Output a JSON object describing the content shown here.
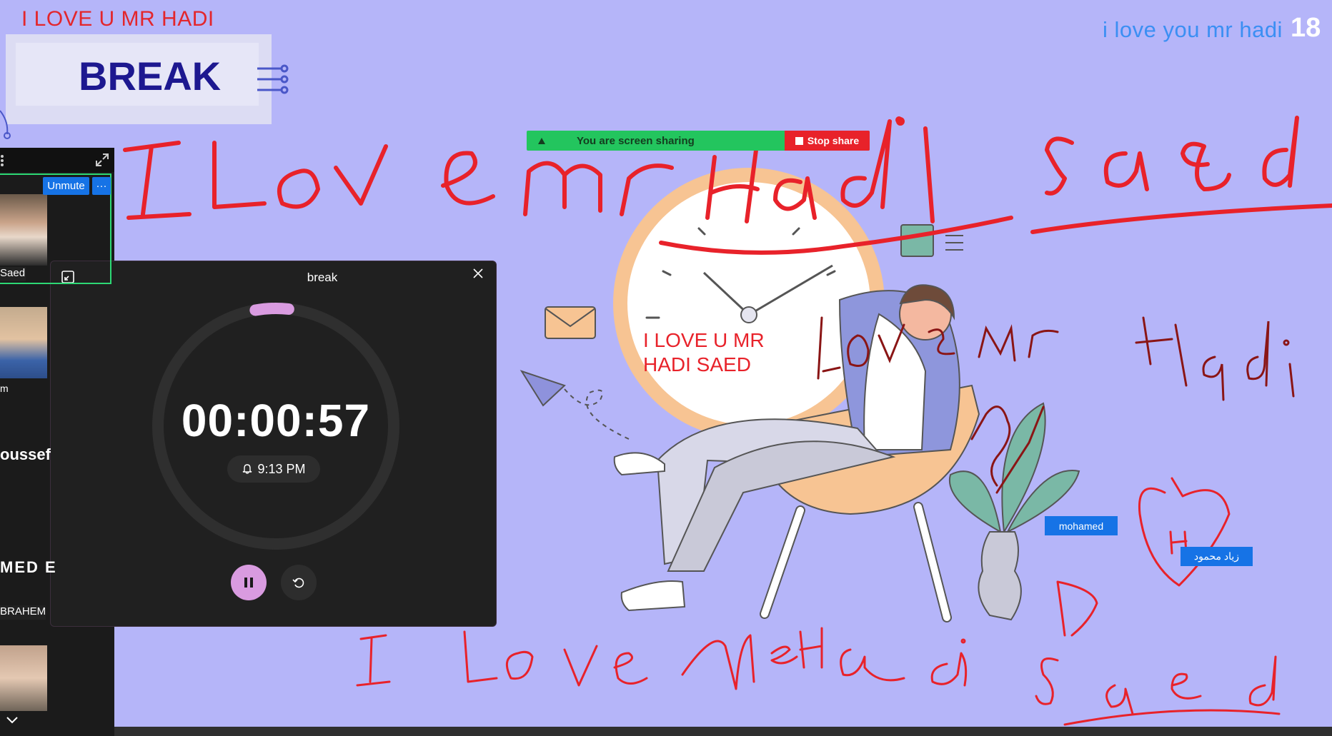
{
  "slide": {
    "red_note_top": "I LOVE U MR HADI",
    "title": "BREAK",
    "top_right_note": "i love you mr hadi",
    "top_right_number": "18",
    "clock_face_note_line1": "I LOVE U MR",
    "clock_face_note_line2": "HADI SAED",
    "background_color": "#b5b5f9"
  },
  "share_bar": {
    "status_text": "You are screen sharing",
    "stop_label": "Stop share",
    "icons": [
      "pin-icon",
      "mic-off-icon",
      "cloud-icon",
      "shield-icon"
    ],
    "bar_color": "#23c55e",
    "stop_color": "#e8222a"
  },
  "participants_panel": {
    "unmute_label": "Unmute",
    "more_label": "···",
    "names": {
      "saed": "Saed",
      "m": "m",
      "youssef": "oussef",
      "med": "MED E",
      "brahem": "BRAHEM"
    }
  },
  "clock_app": {
    "window_title": "break",
    "timer_value": "00:00:57",
    "alarm_time": "9:13 PM",
    "timer_progress": 0.045,
    "accent_color": "#d99be0"
  },
  "name_chips": {
    "mohamed": "mohamed",
    "ziad": "زياد محمود"
  },
  "annotations": {
    "ink_color": "#e8222a",
    "dark_ink_color": "#8a1515"
  }
}
